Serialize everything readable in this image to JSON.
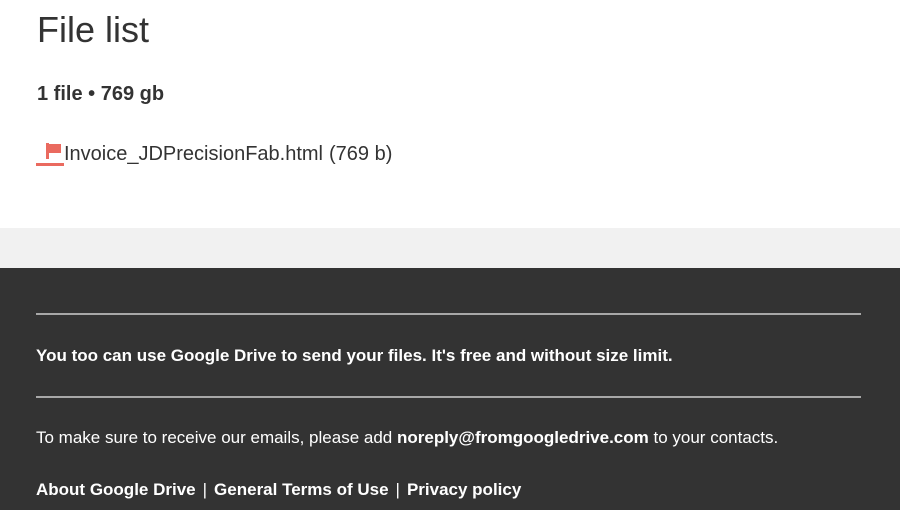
{
  "header": {
    "title": "File list",
    "summary": "1 file • 769 gb"
  },
  "files": [
    {
      "name": "Invoice_JDPrecisionFab.html",
      "size": "(769 b)",
      "icon": "file-flag-icon"
    }
  ],
  "footer": {
    "promo": "You too can use Google Drive to send your files. It's free and without size limit.",
    "contact_prefix": "To make sure to receive our emails, please add",
    "contact_email": "noreply@fromgoogledrive.com",
    "contact_suffix": "to your contacts.",
    "links": [
      {
        "label": "About Google Drive"
      },
      {
        "label": "General Terms of Use"
      },
      {
        "label": "Privacy policy"
      }
    ],
    "separator": "|"
  },
  "colors": {
    "accent": "#ea6a5f",
    "footer_bg": "#333333",
    "band_bg": "#f1f1f1",
    "text": "#333333"
  }
}
